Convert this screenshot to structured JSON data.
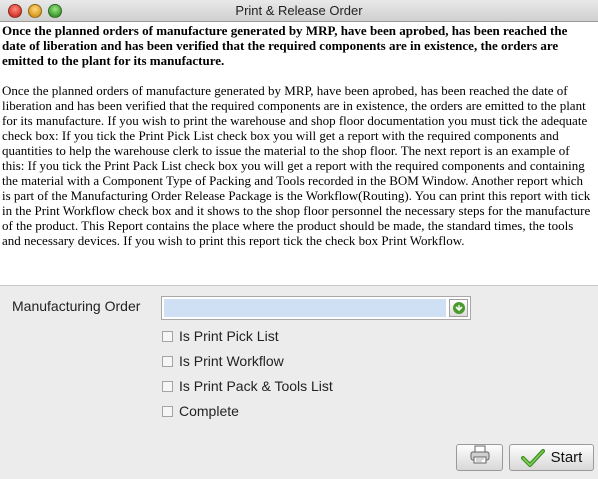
{
  "window": {
    "title": "Print & Release Order"
  },
  "help": {
    "header": "Once the planned orders of manufacture generated by MRP, have been aprobed, has been reached the date of liberation and has been verified that the required components are in existence, the orders are emitted to the plant for its manufacture.",
    "body": "Once the planned orders of manufacture generated by MRP, have been aprobed, has been reached the date of liberation and has been verified that the required components are in existence, the orders are emitted to the plant for its manufacture. If you wish to print the warehouse and shop floor documentation you must tick the adequate check box: If you tick the Print Pick List check box you will get a report with the required components and quantities to help the warehouse clerk to issue the material to the shop floor. The next report is an example of this: If you tick the Print Pack List check box you will get a report with the required components and containing the material with a Component Type of Packing and Tools recorded in the BOM Window. Another report which is part of the Manufacturing Order Release Package is the Workflow(Routing). You can print this report with tick in the Print Workflow check box and it shows to the shop floor personnel the necessary steps for the manufacture of the product. This Report contains the place where the product should be made, the standard times, the tools and necessary devices. If you wish to print this report tick the check box Print Workflow."
  },
  "form": {
    "manufacturing_order_label": "Manufacturing Order",
    "manufacturing_order_value": "",
    "lookup_icon": "green-arrow-lookup-icon",
    "checkboxes": [
      {
        "label": "Is Print Pick List",
        "checked": false
      },
      {
        "label": "Is Print Workflow",
        "checked": false
      },
      {
        "label": "Is Print Pack & Tools List",
        "checked": false
      },
      {
        "label": "Complete",
        "checked": false
      }
    ]
  },
  "buttons": {
    "print_icon": "printer-icon",
    "start_label": "Start",
    "start_icon": "green-checkmark-icon"
  },
  "colors": {
    "input_background": "#cfe0f5",
    "accent_green": "#4a9a2e"
  }
}
